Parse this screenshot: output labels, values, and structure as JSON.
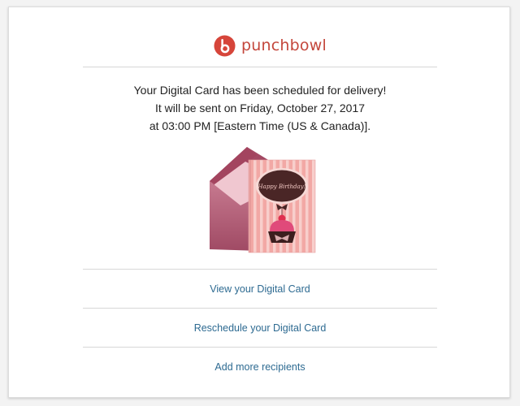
{
  "brand": {
    "name": "punchbowl",
    "color": "#c4473c",
    "icon": "punchbowl-logo-icon"
  },
  "message": {
    "line1": "Your Digital Card has been scheduled for delivery!",
    "line2": "It will be sent on Friday, October 27, 2017",
    "line3": "at 03:00 PM [Eastern Time (US & Canada)]."
  },
  "card_image": {
    "inscription": "Happy Birthday!",
    "icon": "birthday-card-envelope-illustration"
  },
  "links": {
    "view_card": "View your Digital Card",
    "reschedule": "Reschedule your Digital Card",
    "add_recipients": "Add more recipients",
    "color": "#2d6a91"
  }
}
